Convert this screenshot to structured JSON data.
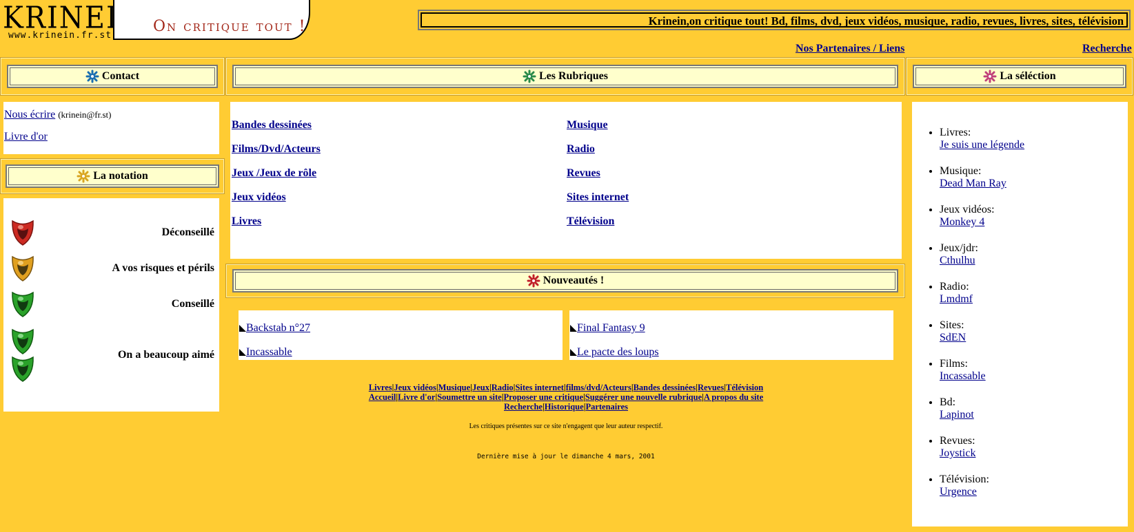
{
  "header": {
    "logo": "KRINEIN",
    "logo_url": "www.krinein.fr.st",
    "slogan": "On critique tout !",
    "banner": "Krinein,on critique tout! Bd, films, dvd, jeux vidéos, musique, radio, revues, livres, sites, télévision",
    "partners_link": "Nos Partenaires / Liens",
    "search_link": "Recherche"
  },
  "contact": {
    "title": "Contact",
    "write_link": "Nous écrire",
    "email": "(krinein@fr.st)",
    "guestbook_link": "Livre d'or"
  },
  "notation": {
    "title": "La notation",
    "levels": [
      {
        "label": "Déconseillé",
        "color": "#cc2a22"
      },
      {
        "label": "A vos risques et périls",
        "color": "#e0a020"
      },
      {
        "label": "Conseillé",
        "color": "#2aa22a"
      },
      {
        "label": "On a beaucoup aimé",
        "color": "#2aa22a"
      }
    ]
  },
  "rubriques": {
    "title": "Les Rubriques",
    "left": [
      "Bandes dessinées",
      "Films/Dvd/Acteurs",
      "Jeux /Jeux de rôle",
      "Jeux vidéos",
      "Livres"
    ],
    "right": [
      "Musique",
      "Radio",
      "Revues",
      "Sites internet",
      "Télévision"
    ]
  },
  "nouveautes": {
    "title": "Nouveautés !",
    "left": [
      "Backstab n°27",
      "Incassable"
    ],
    "right": [
      "Final Fantasy 9",
      "Le pacte des loups"
    ]
  },
  "selection": {
    "title": "La séléction",
    "items": [
      {
        "cat": "Livres:",
        "link": "Je suis une légende"
      },
      {
        "cat": "Musique:",
        "link": "Dead Man Ray"
      },
      {
        "cat": "Jeux vidéos:",
        "link": "Monkey 4"
      },
      {
        "cat": "Jeux/jdr:",
        "link": "Cthulhu"
      },
      {
        "cat": "Radio:",
        "link": "Lmdmf"
      },
      {
        "cat": "Sites:",
        "link": "SdEN"
      },
      {
        "cat": "Films:",
        "link": "Incassable"
      },
      {
        "cat": "Bd:",
        "link": "Lapinot"
      },
      {
        "cat": "Revues:",
        "link": "Joystick"
      },
      {
        "cat": "Télévision:",
        "link": "Urgence"
      }
    ]
  },
  "footer": {
    "line1": [
      "Livres",
      "Jeux vidéos",
      "Musique",
      "Jeux",
      "Radio",
      "Sites internet",
      "films/dvd/Acteurs",
      "Bandes dessinées",
      "Revues",
      "Télévision"
    ],
    "line2": [
      "Accueil",
      "Livre d'or",
      "Soumettre un site",
      "Proposer une critique",
      "Suggérer une nouvelle rubrique",
      "A propos du site"
    ],
    "line3": [
      "Recherche",
      "Historique",
      "Partenaires"
    ],
    "disclaimer": "Les critiques présentes sur ce site n'engagent que leur auteur respectif.",
    "updated": "Dernière mise à jour le dimanche 4 mars, 2001"
  },
  "colors": {
    "background": "#ffcc33",
    "header_fill": "#ffffcc",
    "link": "#00008b",
    "slogan": "#a3281a"
  }
}
